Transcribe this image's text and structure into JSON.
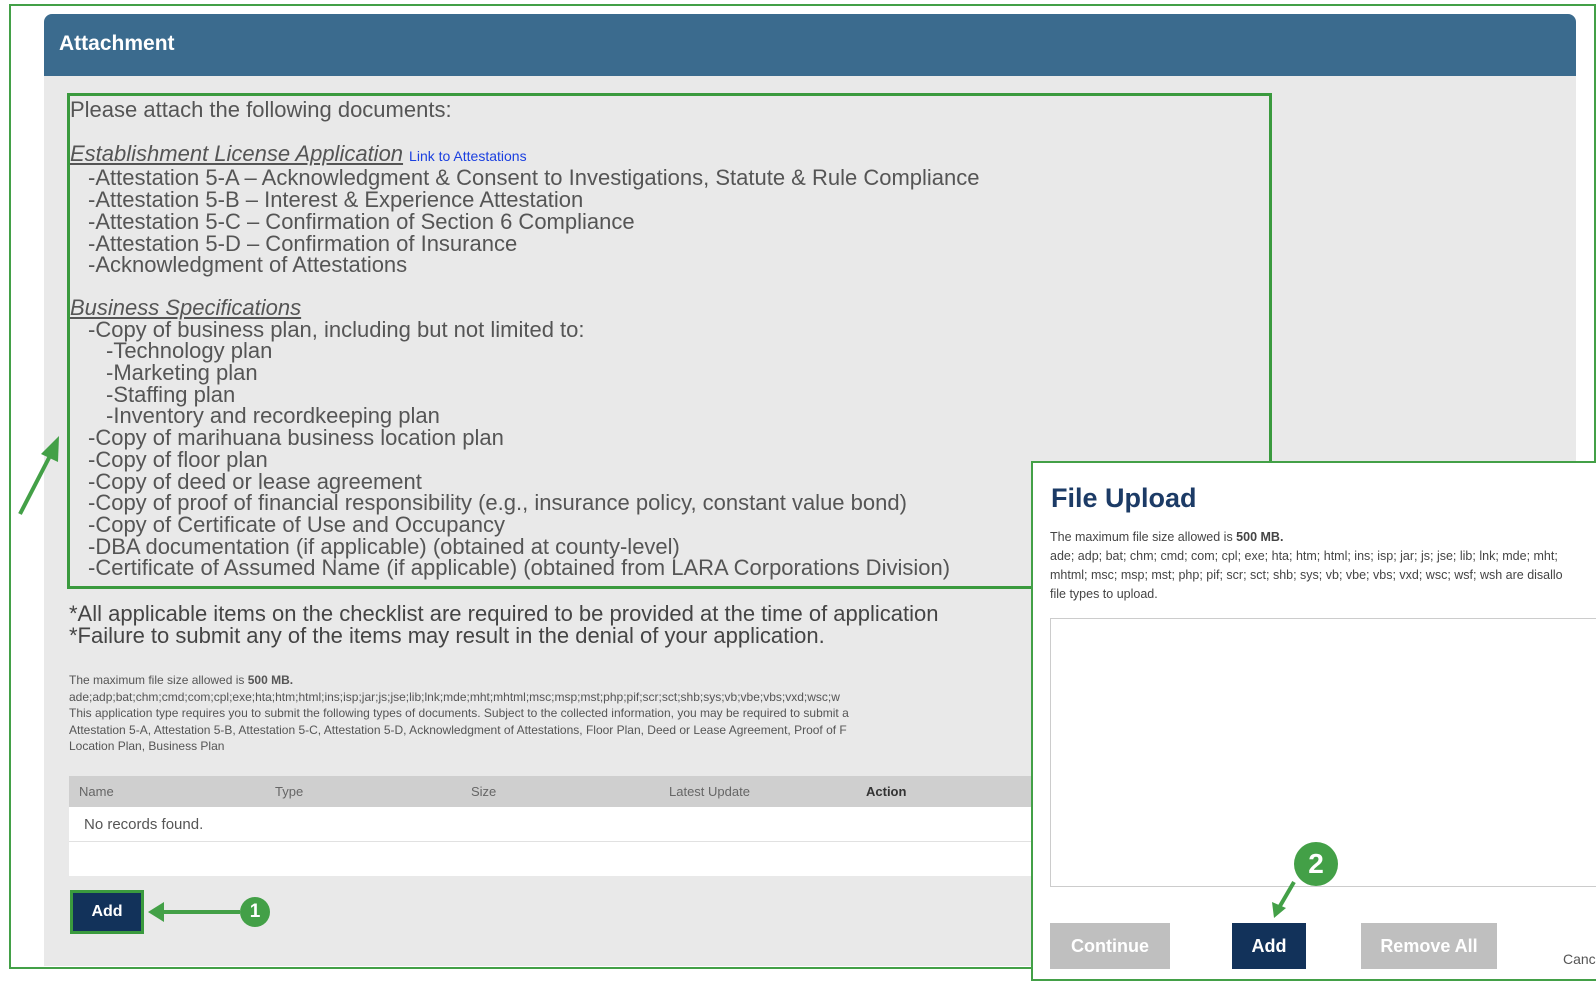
{
  "panel": {
    "title": "Attachment"
  },
  "documents": {
    "intro": "Please attach the following documents:",
    "section1": {
      "heading": "Establishment License Application",
      "link": "Link to Attestations",
      "items": [
        "-Attestation 5-A – Acknowledgment & Consent to Investigations, Statute & Rule Compliance",
        "-Attestation 5-B – Interest & Experience Attestation",
        "-Attestation 5-C – Confirmation of Section 6 Compliance",
        "-Attestation 5-D – Confirmation of Insurance",
        "-Acknowledgment of Attestations"
      ]
    },
    "section2": {
      "heading": "Business Specifications",
      "items": [
        {
          "text": "-Copy of business plan, including but not limited to:",
          "level": 1
        },
        {
          "text": "-Technology plan",
          "level": 2
        },
        {
          "text": "-Marketing plan",
          "level": 2
        },
        {
          "text": "-Staffing plan",
          "level": 2
        },
        {
          "text": "-Inventory and recordkeeping plan",
          "level": 2
        },
        {
          "text": "-Copy of marihuana business location plan",
          "level": 1
        },
        {
          "text": "-Copy of floor plan",
          "level": 1
        },
        {
          "text": "-Copy of deed or lease agreement",
          "level": 1
        },
        {
          "text": "-Copy of proof of financial responsibility (e.g., insurance policy, constant value bond)",
          "level": 1
        },
        {
          "text": "-Copy of Certificate of Use and Occupancy",
          "level": 1
        },
        {
          "text": "-DBA documentation (if applicable) (obtained at county-level)",
          "level": 1
        },
        {
          "text": "-Certificate of Assumed Name (if applicable) (obtained from LARA Corporations Division)",
          "level": 1
        }
      ]
    }
  },
  "notes": {
    "line1": "*All applicable items on the checklist are required to be provided at the time of application",
    "line2": "*Failure to submit any of the items may result in the denial of your application."
  },
  "fine_print": {
    "max_size_prefix": "The maximum file size allowed is ",
    "max_size": "500 MB.",
    "disallowed": "ade;adp;bat;chm;cmd;com;cpl;exe;hta;htm;html;ins;isp;jar;js;jse;lib;lnk;mde;mht;mhtml;msc;msp;mst;php;pif;scr;sct;shb;sys;vb;vbe;vbs;vxd;wsc;w",
    "required_line1": "This application type requires you to submit the following types of documents. Subject to the collected information, you may be required to submit a",
    "required_line2": "Attestation 5-A, Attestation 5-B, Attestation 5-C, Attestation 5-D, Acknowledgment of Attestations, Floor Plan, Deed or Lease Agreement, Proof of F",
    "required_line3": "Location Plan, Business Plan"
  },
  "table": {
    "columns": [
      "Name",
      "Type",
      "Size",
      "Latest Update",
      "Action"
    ],
    "empty": "No records found."
  },
  "buttons": {
    "add": "Add"
  },
  "callouts": {
    "one": "1",
    "two": "2"
  },
  "modal": {
    "title": "File Upload",
    "max_size_prefix": "The maximum file size allowed is ",
    "max_size": "500 MB.",
    "disallowed_line1": "ade; adp; bat; chm; cmd; com; cpl; exe; hta; htm; html; ins; isp; jar; js; jse; lib; lnk; mde; mht;",
    "disallowed_line2": "mhtml; msc; msp; mst; php; pif; scr; sct; shb; sys; vb; vbe; vbs; vxd; wsc; wsf; wsh are disallo",
    "disallowed_line3": "file types to upload.",
    "continue": "Continue",
    "add": "Add",
    "remove_all": "Remove All",
    "cancel": "Canc"
  },
  "colors": {
    "header": "#3b6b8e",
    "accent_green": "#43a047",
    "button_navy": "#12325a",
    "link_blue": "#1a3fe0"
  }
}
